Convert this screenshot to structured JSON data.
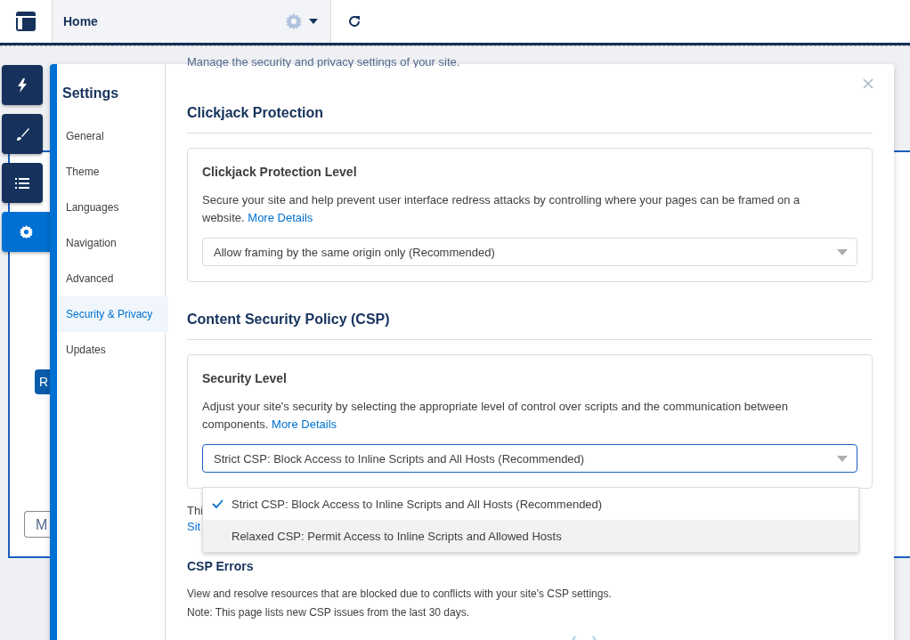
{
  "top_bar": {
    "tab_label": "Home"
  },
  "rail": [
    {
      "kind": "bolt",
      "selected": false
    },
    {
      "kind": "brush",
      "selected": false
    },
    {
      "kind": "list",
      "selected": false
    },
    {
      "kind": "gear",
      "selected": true
    }
  ],
  "canvas": {
    "button_fragment": "R",
    "field_fragment": "M"
  },
  "modal": {
    "nav_title": "Settings",
    "nav_items": [
      {
        "label": "General",
        "selected": false
      },
      {
        "label": "Theme",
        "selected": false
      },
      {
        "label": "Languages",
        "selected": false
      },
      {
        "label": "Navigation",
        "selected": false
      },
      {
        "label": "Advanced",
        "selected": false
      },
      {
        "label": "Security & Privacy",
        "selected": true
      },
      {
        "label": "Updates",
        "selected": false
      }
    ],
    "intro": "Manage the security and privacy settings of your site.",
    "clickjack": {
      "heading": "Clickjack Protection",
      "card_title": "Clickjack Protection Level",
      "description": "Secure your site and help prevent user interface redress attacks by controlling where your pages can be framed on a website.",
      "link": "More Details",
      "select_value": "Allow framing by the same origin only (Recommended)"
    },
    "csp": {
      "heading": "Content Security Policy (CSP)",
      "card_title": "Security Level",
      "description": "Adjust your site's security by selecting the appropriate level of control over scripts and the communication between components.",
      "link": "More Details",
      "select_value": "Strict CSP: Block Access to Inline Scripts and All Hosts (Recommended)",
      "options": [
        {
          "label": "Strict CSP: Block Access to Inline Scripts and All Hosts (Recommended)",
          "selected": true,
          "hovered": false
        },
        {
          "label": "Relaxed CSP: Permit Access to Inline Scripts and Allowed Hosts",
          "selected": false,
          "hovered": true
        }
      ],
      "note_fragment": "Thi",
      "link_fragment": "Sit"
    },
    "errors": {
      "heading": "CSP Errors",
      "lines": [
        "View and resolve resources that are blocked due to conflicts with your site's CSP settings.",
        "Note: This page lists new CSP issues from the last 30 days."
      ]
    }
  }
}
